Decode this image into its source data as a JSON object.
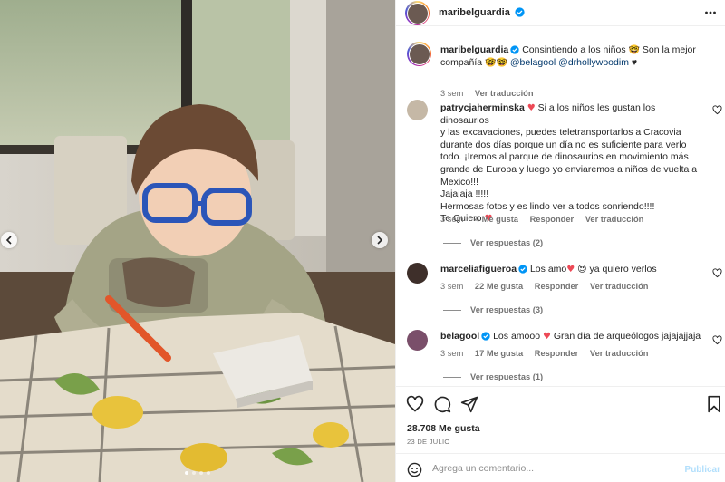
{
  "post": {
    "author": "maribelguardia",
    "more_label": "Más opciones"
  },
  "caption": {
    "username": "maribelguardia",
    "text_1": "Consintiendo a los niños",
    "emoji_1": "🤓",
    "text_2": "Son la mejor compañía",
    "emoji_2": "🤓🤓",
    "mention_1": "@belagool",
    "mention_2": "@drhollywoodim",
    "end": "♥",
    "time": "3 sem",
    "translate": "Ver traducción"
  },
  "comments": [
    {
      "username": "patrycjaherminska",
      "heart": "♥",
      "lines": [
        "Si a los niños les gustan los dinosaurios",
        "y las excavaciones, puedes teletransportarlos a Cracovia",
        "durante dos días porque un día no es suficiente para verlo",
        "todo. ¡Iremos al parque de dinosaurios en movimiento más",
        "grande de Europa y luego yo enviaremos a niños de vuelta a",
        "Mexico!!!",
        "Jajajaja !!!!!",
        "Hermosas fotos y es lindo ver a todos sonriendo!!!!",
        "Te Quiero"
      ],
      "time": "3 sem",
      "likes": "4 Me gusta",
      "reply": "Responder",
      "translate": "Ver traducción",
      "replies": "Ver respuestas (2)"
    },
    {
      "username": "marceliafigueroa",
      "text": "Los amo",
      "emoji": "😍",
      "text_after": "ya quiero verlos",
      "time": "3 sem",
      "likes": "22 Me gusta",
      "reply": "Responder",
      "translate": "Ver traducción",
      "replies": "Ver respuestas (3)"
    },
    {
      "username": "belagool",
      "text": "Los amooo",
      "text_after": "Gran día de arqueólogos jajajajjaja",
      "time": "3 sem",
      "likes": "17 Me gusta",
      "reply": "Responder",
      "translate": "Ver traducción",
      "replies": "Ver respuestas (1)"
    }
  ],
  "stats": {
    "likes": "28.708 Me gusta",
    "date": "23 DE JULIO"
  },
  "composer": {
    "placeholder": "Agrega un comentario...",
    "publish": "Publicar"
  },
  "icons": {
    "like": "heart-icon",
    "comment": "comment-icon",
    "share": "send-icon",
    "save": "bookmark-icon",
    "emoji": "emoji-icon",
    "verified": "verified-badge-icon"
  },
  "colors": {
    "accent": "#0095f6",
    "verified": "#0095f6",
    "heart": "#ed4956",
    "muted": "#737373",
    "publish_disabled": "#b2dffc"
  }
}
